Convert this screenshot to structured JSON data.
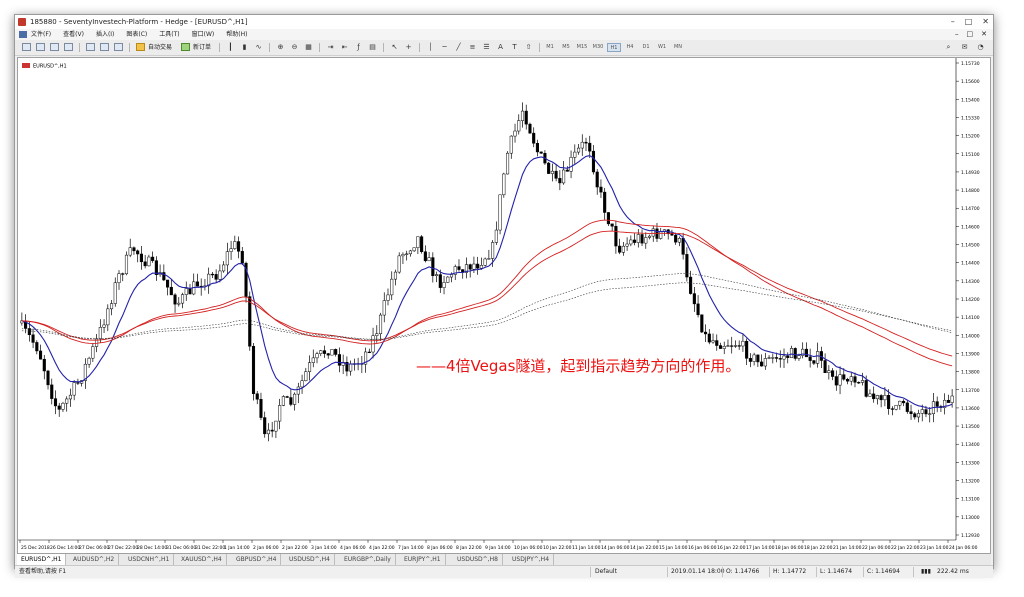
{
  "window": {
    "title": "185880 - SeventyInvestech-Platform - Hedge - [EURUSD^,H1]",
    "controls": [
      "–",
      "□",
      "✕"
    ]
  },
  "menu": {
    "items": [
      "文件(F)",
      "查看(V)",
      "插入(I)",
      "图表(C)",
      "工具(T)",
      "窗口(W)",
      "帮助(H)"
    ],
    "right_controls": [
      "–",
      "□",
      "✕"
    ]
  },
  "toolbar": {
    "auto_trade_label": "自动交易",
    "new_order_label": "新订单",
    "timeframes": [
      "M1",
      "M5",
      "M15",
      "M30",
      "H1",
      "H4",
      "D1",
      "W1",
      "MN"
    ],
    "active_timeframe": "H1"
  },
  "chart": {
    "symbol_label": "EURUSD^,H1",
    "annotation": "——4倍Vegas隧道，起到指示趋势方向的作用。",
    "colors": {
      "candles": "#000000",
      "fast_ma": "#2222aa",
      "tunnel": "#d42020",
      "slow_ma": "#333333",
      "annotation": "#ee1111"
    },
    "price_labels": [
      "1.15730",
      "1.15600",
      "1.15400",
      "1.15330",
      "1.15200",
      "1.15100",
      "1.14930",
      "1.14800",
      "1.14700",
      "1.14600",
      "1.14500",
      "1.14400",
      "1.14300",
      "1.14200",
      "1.14100",
      "1.14000",
      "1.13900",
      "1.13800",
      "1.13700",
      "1.13600",
      "1.13500",
      "1.13400",
      "1.13300",
      "1.13200",
      "1.13100",
      "1.13000",
      "1.12930"
    ],
    "time_labels": [
      "25 Dec 2018",
      "26 Dec 14:00",
      "27 Dec 06:00",
      "27 Dec 22:00",
      "28 Dec 14:00",
      "31 Dec 06:00",
      "31 Dec 22:00",
      "1 Jan 14:00",
      "2 Jan 06:00",
      "2 Jan 22:00",
      "3 Jan 14:00",
      "4 Jan 06:00",
      "4 Jan 22:00",
      "7 Jan 14:00",
      "8 Jan 06:00",
      "8 Jan 22:00",
      "9 Jan 14:00",
      "10 Jan 06:00",
      "10 Jan 22:00",
      "11 Jan 14:00",
      "14 Jan 06:00",
      "14 Jan 22:00",
      "15 Jan 14:00",
      "16 Jan 06:00",
      "16 Jan 22:00",
      "17 Jan 14:00",
      "18 Jan 06:00",
      "18 Jan 22:00",
      "21 Jan 14:00",
      "22 Jan 06:00",
      "22 Jan 22:00",
      "23 Jan 14:00",
      "24 Jan 06:00"
    ]
  },
  "tabs": [
    "EURUSD^,H1",
    "AUDUSD^,H2",
    "USDCNH^,H1",
    "XAUUSD^,H4",
    "GBPUSD^,H4",
    "USDUSD^,H4",
    "EURGBP^,Daily",
    "EURJPY^,H1",
    "USDUSD^,H8",
    "USDJPY^,H4"
  ],
  "status": {
    "help": "查看帮助,请按 F1",
    "profile": "Default",
    "datetime": "2019.01.14 18:00",
    "open": "O: 1.14766",
    "high": "H: 1.14772",
    "low": "L: 1.14674",
    "close": "C: 1.14694",
    "traffic": "222.42 ms"
  }
}
